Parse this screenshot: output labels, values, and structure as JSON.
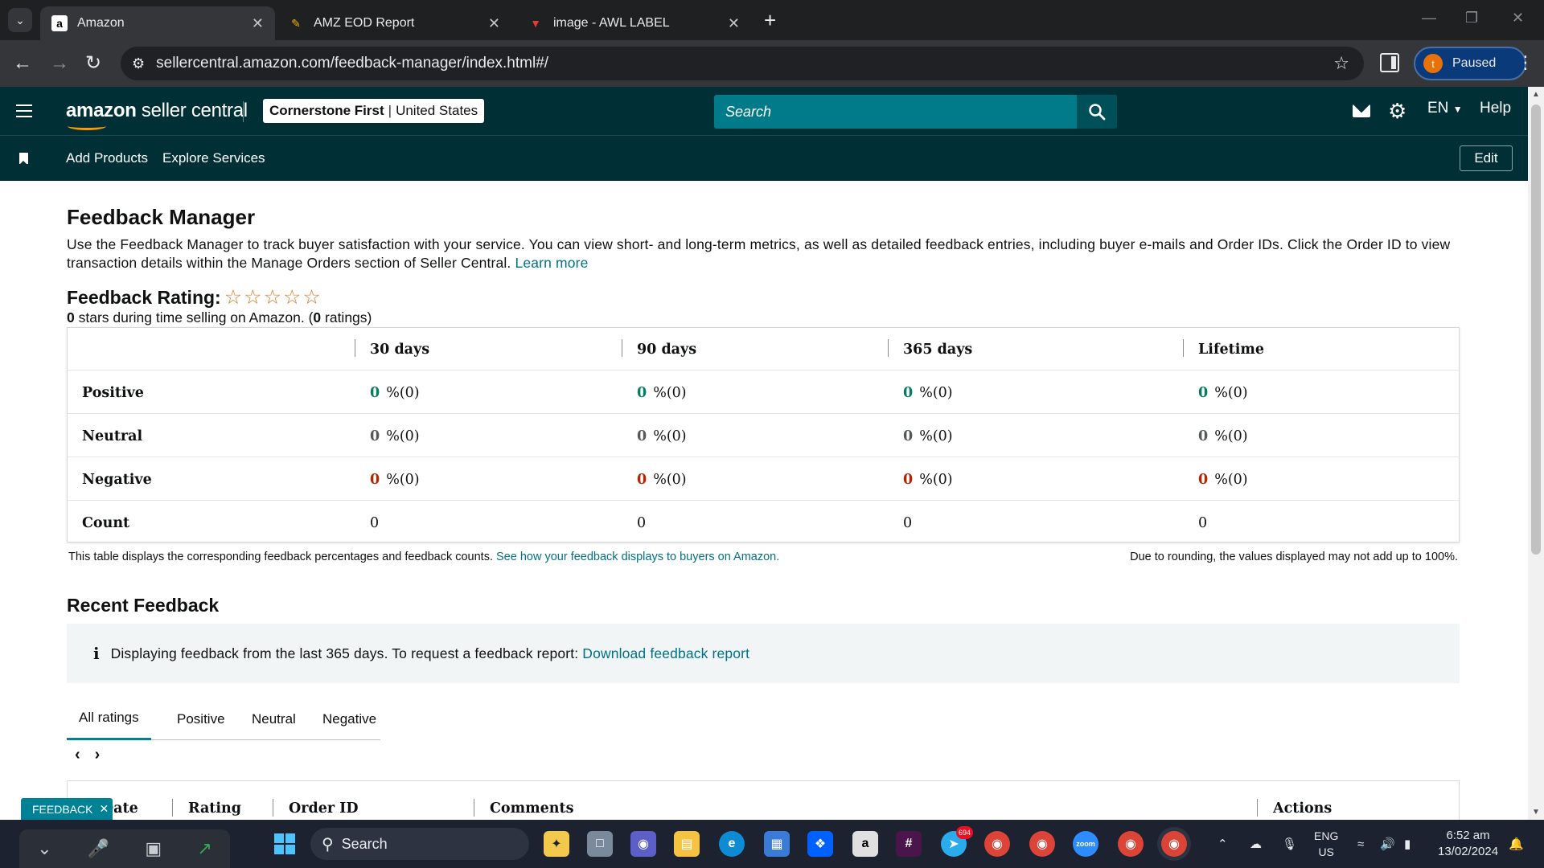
{
  "browser": {
    "tabs": [
      {
        "title": "Amazon",
        "favicon": "amazon-favicon",
        "active": true
      },
      {
        "title": "AMZ EOD Report",
        "favicon": "colorful-pen-favicon",
        "active": false
      },
      {
        "title": "image - AWL LABEL",
        "favicon": "red-wings-favicon",
        "active": false
      }
    ],
    "url": "sellercentral.amazon.com/feedback-manager/index.html#/",
    "profile_initial": "t",
    "profile_label": "Paused"
  },
  "header": {
    "logo_bold": "amazon",
    "logo_rest": " seller central",
    "store_name": "Cornerstone First",
    "marketplace": "United States",
    "search_placeholder": "Search",
    "language": "EN",
    "help": "Help"
  },
  "subnav": {
    "links": [
      "Add Products",
      "Explore Services"
    ],
    "edit": "Edit"
  },
  "page": {
    "title": "Feedback Manager",
    "intro": "Use the Feedback Manager to track buyer satisfaction with your service. You can view short- and long-term metrics, as well as detailed feedback entries, including buyer e-mails and Order IDs. Click the Order ID to view transaction details within the Manage Orders section of Seller Central.",
    "learn_more": "Learn more",
    "rating_label": "Feedback Rating:",
    "stars_filled": 0,
    "stars_total": 5,
    "summary_stars": "0",
    "summary_mid": " stars during time selling on Amazon. (",
    "summary_ratings": "0",
    "summary_end": " ratings)"
  },
  "feedback_table": {
    "columns": [
      "30 days",
      "90 days",
      "365 days",
      "Lifetime"
    ],
    "rows": [
      {
        "label": "Positive",
        "kind": "pos",
        "cells": [
          [
            "0",
            "%(0)"
          ],
          [
            "0",
            "%(0)"
          ],
          [
            "0",
            "%(0)"
          ],
          [
            "0",
            "%(0)"
          ]
        ]
      },
      {
        "label": "Neutral",
        "kind": "neu",
        "cells": [
          [
            "0",
            "%(0)"
          ],
          [
            "0",
            "%(0)"
          ],
          [
            "0",
            "%(0)"
          ],
          [
            "0",
            "%(0)"
          ]
        ]
      },
      {
        "label": "Negative",
        "kind": "neg",
        "cells": [
          [
            "0",
            "%(0)"
          ],
          [
            "0",
            "%(0)"
          ],
          [
            "0",
            "%(0)"
          ],
          [
            "0",
            "%(0)"
          ]
        ]
      },
      {
        "label": "Count",
        "kind": "count",
        "cells": [
          [
            "",
            "0"
          ],
          [
            "",
            "0"
          ],
          [
            "",
            "0"
          ],
          [
            "",
            "0"
          ]
        ]
      }
    ],
    "note": "This table displays the corresponding feedback percentages and feedback counts.",
    "note_link": "See how your feedback displays to buyers on Amazon.",
    "rounding_note": "Due to rounding, the values displayed may not add up to 100%."
  },
  "recent": {
    "title": "Recent Feedback",
    "info_text": "Displaying feedback from the last 365 days. To request a feedback report:",
    "info_link": "Download feedback report",
    "tabs": [
      "All ratings",
      "Positive",
      "Neutral",
      "Negative"
    ],
    "active_tab": 0,
    "list_columns": [
      "Date",
      "Rating",
      "Order ID",
      "Comments",
      "Actions"
    ],
    "float_button": "FEEDBACK"
  },
  "taskbar": {
    "search": "Search",
    "lang_top": "ENG",
    "lang_bottom": "US",
    "time": "6:52 am",
    "date": "13/02/2024",
    "telegram_badge": "694"
  },
  "colors": {
    "header_bg": "#002f36",
    "search_bg": "#017a8a",
    "link": "#007185",
    "positive": "#067d62",
    "negative": "#b12704",
    "star": "#de7921"
  }
}
